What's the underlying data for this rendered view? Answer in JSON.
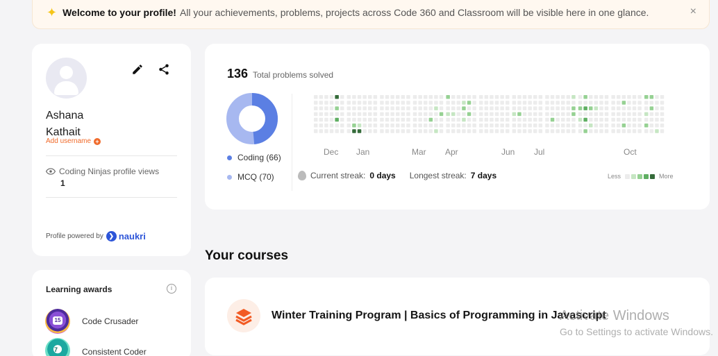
{
  "banner": {
    "bold": "Welcome to your profile!",
    "text": "All your achievements, problems, projects across Code 360 and Classroom will be visible here in one glance.",
    "close": "×",
    "icon": "sparkle-icon"
  },
  "profile": {
    "first_name": "Ashana",
    "last_name": "Kathait",
    "add_username": "Add username",
    "views_label": "Coding Ninjas profile views",
    "views_count": "1",
    "powered_by": "Profile powered by",
    "naukri": "naukri"
  },
  "awards": {
    "title": "Learning awards",
    "items": [
      {
        "label": "Code Crusader",
        "badge_text": "15"
      },
      {
        "label": "Consistent Coder",
        "badge_text": "7"
      }
    ]
  },
  "stats": {
    "total": "136",
    "total_label": "Total problems solved",
    "coding_label": "Coding (66)",
    "coding_value": 66,
    "mcq_label": "MCQ (70)",
    "mcq_value": 70,
    "colors": {
      "coding": "#5b7fe3",
      "mcq": "#a7b8f0"
    },
    "months": [
      "Dec",
      "Jan",
      "Mar",
      "Apr",
      "Jun",
      "Jul",
      "Oct"
    ],
    "current_streak_label": "Current streak:",
    "current_streak_value": "0 days",
    "longest_streak_label": "Longest streak:",
    "longest_streak_value": "7 days",
    "less": "Less",
    "more": "More",
    "heat_colors": [
      "#ececec",
      "#c6e6c3",
      "#96d193",
      "#5fae62",
      "#356b3a"
    ]
  },
  "courses": {
    "title": "Your courses",
    "items": [
      {
        "name": "Winter Training Program | Basics of Programming in Javascript"
      }
    ]
  },
  "watermark": {
    "line1": "Activate Windows",
    "line2": "Go to Settings to activate Windows."
  }
}
